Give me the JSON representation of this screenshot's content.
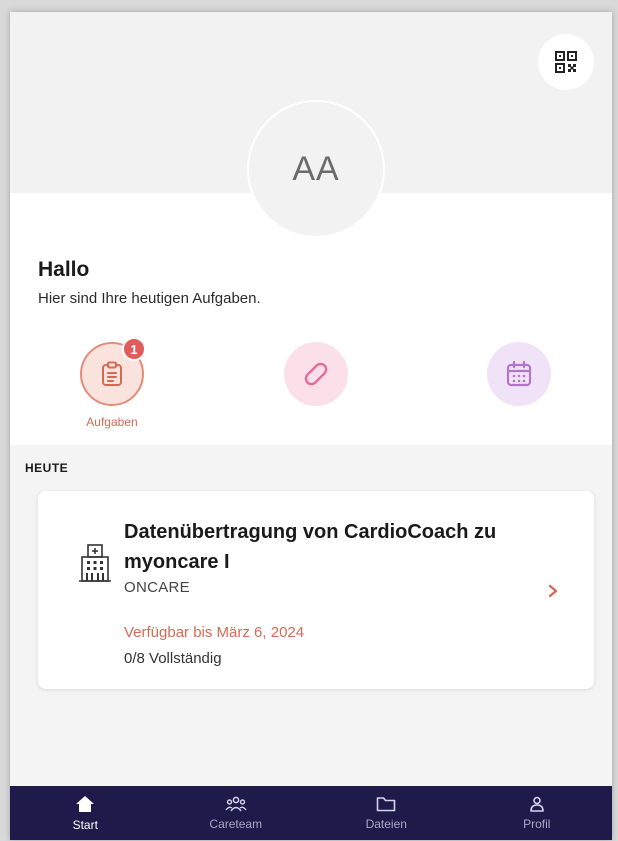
{
  "header": {
    "avatar_initials": "AA",
    "qr_icon": "qr-code-icon"
  },
  "greeting": {
    "title": "Hallo",
    "subtitle": "Hier sind Ihre heutigen Aufgaben."
  },
  "quick_actions": [
    {
      "label": "Aufgaben",
      "icon": "clipboard-icon",
      "badge": "1",
      "color": "#e58b78"
    },
    {
      "label": "",
      "icon": "pill-icon",
      "color": "#e86a98"
    },
    {
      "label": "",
      "icon": "calendar-icon",
      "color": "#b474c8"
    }
  ],
  "today": {
    "section_title": "HEUTE",
    "task": {
      "title": "Datenübertragung von CardioCoach zu myoncare I",
      "organization": "ONCARE",
      "due": "Verfügbar bis März 6, 2024",
      "progress": "0/8 Vollständig",
      "icon": "hospital-icon"
    }
  },
  "bottom_nav": [
    {
      "label": "Start",
      "icon": "home-icon",
      "active": true
    },
    {
      "label": "Careteam",
      "icon": "team-icon",
      "active": false
    },
    {
      "label": "Dateien",
      "icon": "folder-icon",
      "active": false
    },
    {
      "label": "Profil",
      "icon": "person-icon",
      "active": false
    }
  ],
  "colors": {
    "accent": "#d46a55",
    "nav_background": "#1e1b4b",
    "badge": "#e25b5b"
  }
}
